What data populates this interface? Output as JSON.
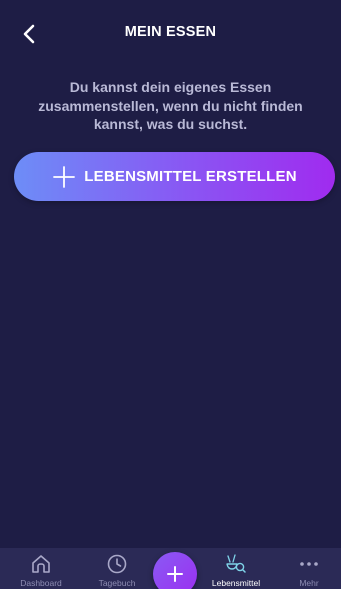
{
  "header": {
    "title": "MEIN ESSEN",
    "back_icon": "chevron-left-icon"
  },
  "main": {
    "info_text": "Du kannst dein eigenes Essen zusammenstellen, wenn du nicht finden kannst, was du suchst.",
    "create_button_label": "LEBENSMITTEL ERSTELLEN",
    "create_button_icon": "plus-icon"
  },
  "bottom_nav": {
    "items": [
      {
        "label": "Dashboard",
        "icon": "home-icon"
      },
      {
        "label": "Tagebuch",
        "icon": "clock-icon"
      },
      {
        "label": "Lebensmittel",
        "icon": "food-search-icon",
        "active": true
      },
      {
        "label": "Mehr",
        "icon": "more-dots-icon"
      }
    ],
    "fab_icon": "plus-icon"
  },
  "colors": {
    "background": "#1e1d45",
    "nav_background": "#2b2a56",
    "accent_start": "#6d8df7",
    "accent_end": "#a02bef",
    "active_icon": "#7fd3e8",
    "inactive": "#8e8db3"
  }
}
